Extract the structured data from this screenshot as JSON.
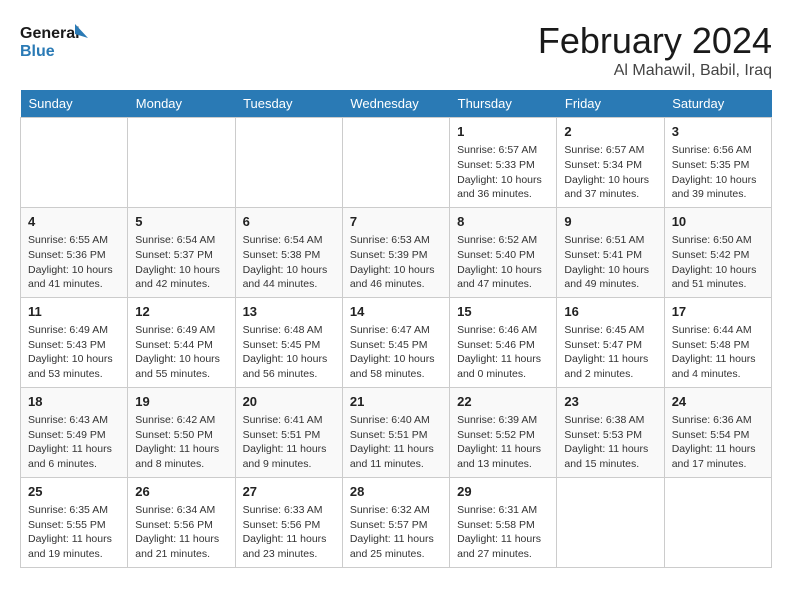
{
  "header": {
    "logo_line1": "General",
    "logo_line2": "Blue",
    "title": "February 2024",
    "subtitle": "Al Mahawil, Babil, Iraq"
  },
  "days_of_week": [
    "Sunday",
    "Monday",
    "Tuesday",
    "Wednesday",
    "Thursday",
    "Friday",
    "Saturday"
  ],
  "weeks": [
    [
      {
        "day": "",
        "info": ""
      },
      {
        "day": "",
        "info": ""
      },
      {
        "day": "",
        "info": ""
      },
      {
        "day": "",
        "info": ""
      },
      {
        "day": "1",
        "info": "Sunrise: 6:57 AM\nSunset: 5:33 PM\nDaylight: 10 hours\nand 36 minutes."
      },
      {
        "day": "2",
        "info": "Sunrise: 6:57 AM\nSunset: 5:34 PM\nDaylight: 10 hours\nand 37 minutes."
      },
      {
        "day": "3",
        "info": "Sunrise: 6:56 AM\nSunset: 5:35 PM\nDaylight: 10 hours\nand 39 minutes."
      }
    ],
    [
      {
        "day": "4",
        "info": "Sunrise: 6:55 AM\nSunset: 5:36 PM\nDaylight: 10 hours\nand 41 minutes."
      },
      {
        "day": "5",
        "info": "Sunrise: 6:54 AM\nSunset: 5:37 PM\nDaylight: 10 hours\nand 42 minutes."
      },
      {
        "day": "6",
        "info": "Sunrise: 6:54 AM\nSunset: 5:38 PM\nDaylight: 10 hours\nand 44 minutes."
      },
      {
        "day": "7",
        "info": "Sunrise: 6:53 AM\nSunset: 5:39 PM\nDaylight: 10 hours\nand 46 minutes."
      },
      {
        "day": "8",
        "info": "Sunrise: 6:52 AM\nSunset: 5:40 PM\nDaylight: 10 hours\nand 47 minutes."
      },
      {
        "day": "9",
        "info": "Sunrise: 6:51 AM\nSunset: 5:41 PM\nDaylight: 10 hours\nand 49 minutes."
      },
      {
        "day": "10",
        "info": "Sunrise: 6:50 AM\nSunset: 5:42 PM\nDaylight: 10 hours\nand 51 minutes."
      }
    ],
    [
      {
        "day": "11",
        "info": "Sunrise: 6:49 AM\nSunset: 5:43 PM\nDaylight: 10 hours\nand 53 minutes."
      },
      {
        "day": "12",
        "info": "Sunrise: 6:49 AM\nSunset: 5:44 PM\nDaylight: 10 hours\nand 55 minutes."
      },
      {
        "day": "13",
        "info": "Sunrise: 6:48 AM\nSunset: 5:45 PM\nDaylight: 10 hours\nand 56 minutes."
      },
      {
        "day": "14",
        "info": "Sunrise: 6:47 AM\nSunset: 5:45 PM\nDaylight: 10 hours\nand 58 minutes."
      },
      {
        "day": "15",
        "info": "Sunrise: 6:46 AM\nSunset: 5:46 PM\nDaylight: 11 hours\nand 0 minutes."
      },
      {
        "day": "16",
        "info": "Sunrise: 6:45 AM\nSunset: 5:47 PM\nDaylight: 11 hours\nand 2 minutes."
      },
      {
        "day": "17",
        "info": "Sunrise: 6:44 AM\nSunset: 5:48 PM\nDaylight: 11 hours\nand 4 minutes."
      }
    ],
    [
      {
        "day": "18",
        "info": "Sunrise: 6:43 AM\nSunset: 5:49 PM\nDaylight: 11 hours\nand 6 minutes."
      },
      {
        "day": "19",
        "info": "Sunrise: 6:42 AM\nSunset: 5:50 PM\nDaylight: 11 hours\nand 8 minutes."
      },
      {
        "day": "20",
        "info": "Sunrise: 6:41 AM\nSunset: 5:51 PM\nDaylight: 11 hours\nand 9 minutes."
      },
      {
        "day": "21",
        "info": "Sunrise: 6:40 AM\nSunset: 5:51 PM\nDaylight: 11 hours\nand 11 minutes."
      },
      {
        "day": "22",
        "info": "Sunrise: 6:39 AM\nSunset: 5:52 PM\nDaylight: 11 hours\nand 13 minutes."
      },
      {
        "day": "23",
        "info": "Sunrise: 6:38 AM\nSunset: 5:53 PM\nDaylight: 11 hours\nand 15 minutes."
      },
      {
        "day": "24",
        "info": "Sunrise: 6:36 AM\nSunset: 5:54 PM\nDaylight: 11 hours\nand 17 minutes."
      }
    ],
    [
      {
        "day": "25",
        "info": "Sunrise: 6:35 AM\nSunset: 5:55 PM\nDaylight: 11 hours\nand 19 minutes."
      },
      {
        "day": "26",
        "info": "Sunrise: 6:34 AM\nSunset: 5:56 PM\nDaylight: 11 hours\nand 21 minutes."
      },
      {
        "day": "27",
        "info": "Sunrise: 6:33 AM\nSunset: 5:56 PM\nDaylight: 11 hours\nand 23 minutes."
      },
      {
        "day": "28",
        "info": "Sunrise: 6:32 AM\nSunset: 5:57 PM\nDaylight: 11 hours\nand 25 minutes."
      },
      {
        "day": "29",
        "info": "Sunrise: 6:31 AM\nSunset: 5:58 PM\nDaylight: 11 hours\nand 27 minutes."
      },
      {
        "day": "",
        "info": ""
      },
      {
        "day": "",
        "info": ""
      }
    ]
  ]
}
